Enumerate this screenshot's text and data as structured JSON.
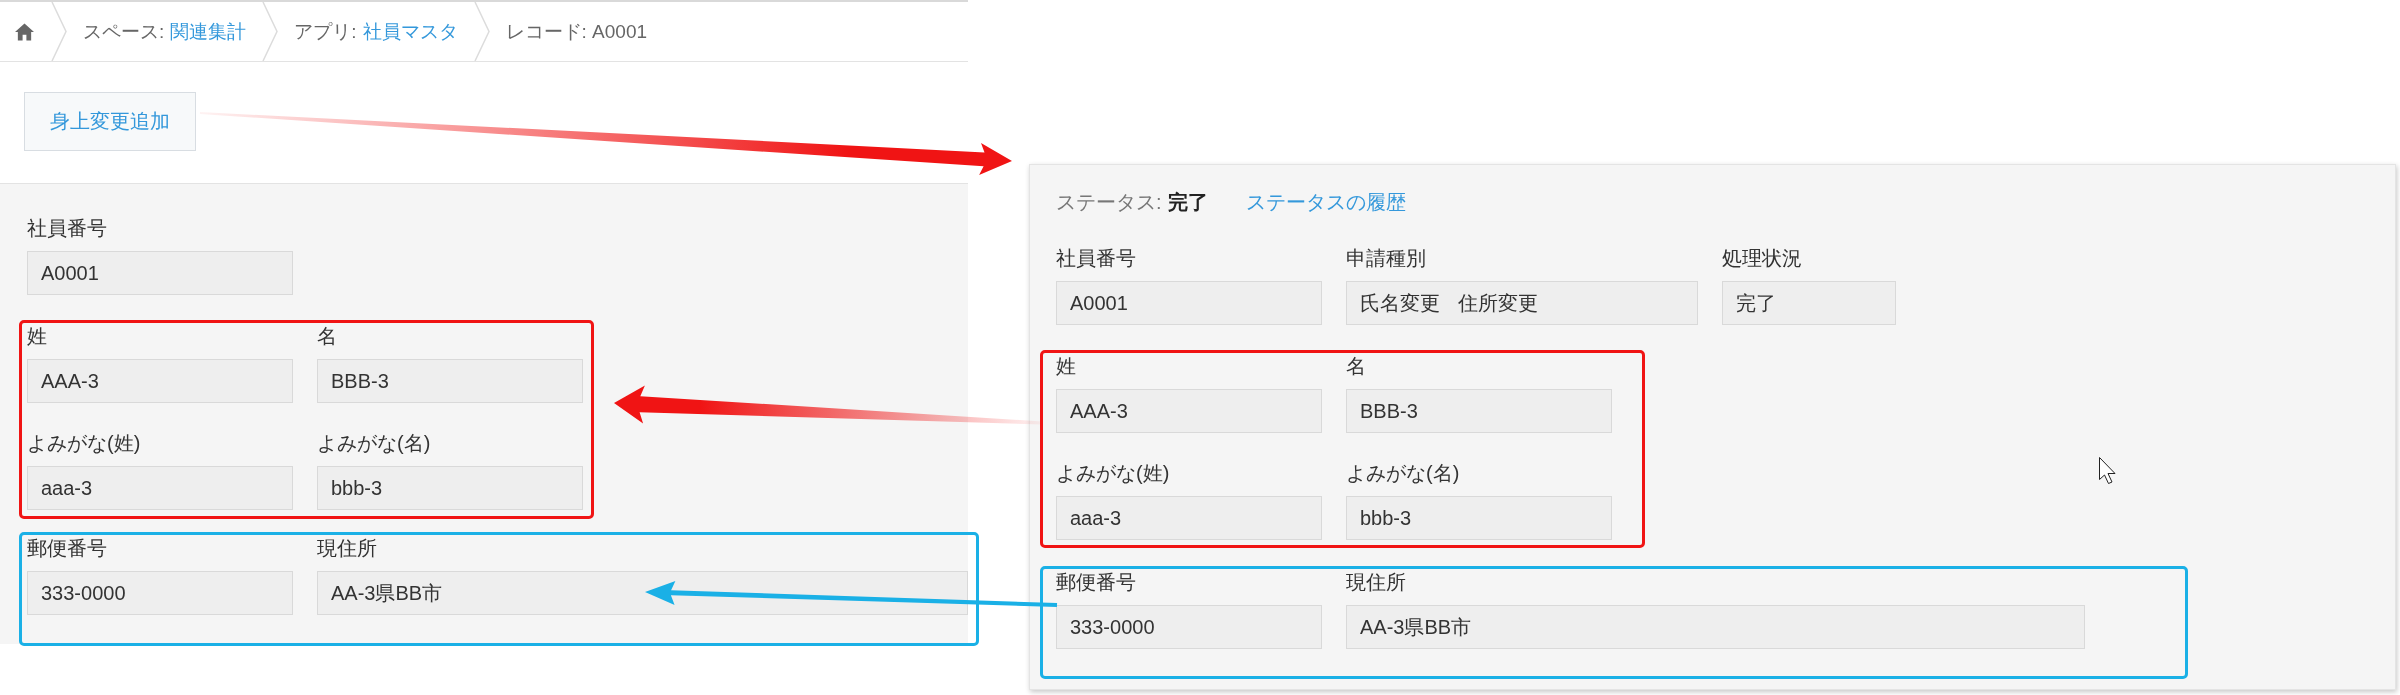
{
  "breadcrumb": {
    "items": [
      {
        "kind": "home"
      },
      {
        "kind": "link",
        "label": "スペース:",
        "link": "関連集計"
      },
      {
        "kind": "link",
        "label": "アプリ:",
        "link": "社員マスタ"
      },
      {
        "kind": "current",
        "text": "レコード: A0001"
      }
    ]
  },
  "toolbar": {
    "buttons": [
      "身上変更追加"
    ]
  },
  "record_form": {
    "groups": [
      {
        "outlined": false,
        "rows": [
          [
            {
              "label": "社員番号",
              "value": "A0001"
            }
          ]
        ]
      },
      {
        "outlined": true,
        "color": "#f01414",
        "rows": [
          [
            {
              "label": "姓",
              "value": "AAA-3"
            },
            {
              "label": "名",
              "value": "BBB-3"
            }
          ],
          [
            {
              "label": "よみがな(姓)",
              "value": "aaa-3"
            },
            {
              "label": "よみがな(名)",
              "value": "bbb-3"
            }
          ]
        ]
      },
      {
        "outlined": true,
        "color": "#1ab0e6",
        "rows": [
          [
            {
              "label": "郵便番号",
              "value": "333-0000"
            },
            {
              "label": "現住所",
              "value": "AA-3県BB市"
            }
          ]
        ]
      }
    ]
  },
  "status_record": {
    "status": {
      "label": "ステータス:",
      "value": "完了"
    },
    "history_link": "ステータスの履歴",
    "groups": [
      {
        "outlined": false,
        "rows": [
          [
            {
              "label": "社員番号",
              "value": "A0001"
            },
            {
              "label": "申請種別",
              "values": [
                "氏名変更",
                "住所変更"
              ]
            },
            {
              "label": "処理状況",
              "value": "完了"
            }
          ]
        ]
      },
      {
        "outlined": true,
        "color": "#f01414",
        "rows": [
          [
            {
              "label": "姓",
              "value": "AAA-3"
            },
            {
              "label": "名",
              "value": "BBB-3"
            }
          ],
          [
            {
              "label": "よみがな(姓)",
              "value": "aaa-3"
            },
            {
              "label": "よみがな(名)",
              "value": "bbb-3"
            }
          ]
        ]
      },
      {
        "outlined": true,
        "color": "#1ab0e6",
        "rows": [
          [
            {
              "label": "郵便番号",
              "value": "333-0000"
            },
            {
              "label": "現住所",
              "value": "AA-3県BB市"
            }
          ]
        ]
      }
    ]
  },
  "annotations": {
    "arrows": [
      {
        "color": "#f01414"
      },
      {
        "color": "#f01414"
      },
      {
        "color": "#1ab0e6"
      }
    ]
  }
}
